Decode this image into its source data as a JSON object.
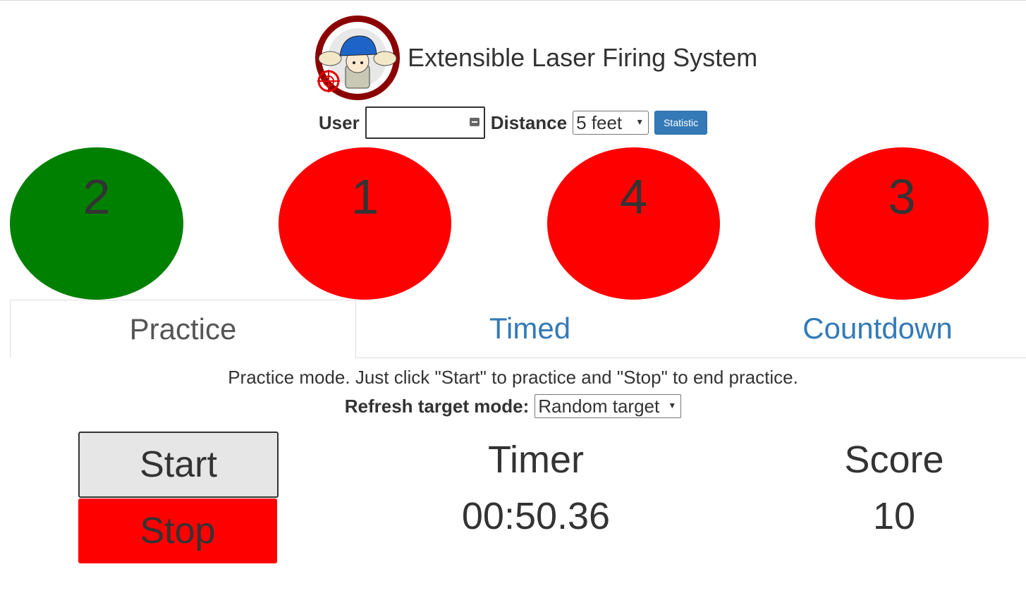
{
  "app": {
    "title": "Extensible Laser Firing System"
  },
  "controls": {
    "user_label": "User",
    "user_value": "",
    "distance_label": "Distance",
    "distance_selected": "5 feet",
    "statistic_button": "Statistic"
  },
  "targets": [
    {
      "number": "2",
      "color": "#008000"
    },
    {
      "number": "1",
      "color": "#ff0000"
    },
    {
      "number": "4",
      "color": "#ff0000"
    },
    {
      "number": "3",
      "color": "#ff0000"
    }
  ],
  "tabs": [
    {
      "label": "Practice",
      "active": true
    },
    {
      "label": "Timed",
      "active": false
    },
    {
      "label": "Countdown",
      "active": false
    }
  ],
  "practice": {
    "description": "Practice mode. Just click \"Start\" to practice and \"Stop\" to end practice.",
    "refresh_label": "Refresh target mode:",
    "refresh_selected": "Random target"
  },
  "buttons": {
    "start": "Start",
    "stop": "Stop"
  },
  "timer": {
    "label": "Timer",
    "value": "00:50.36"
  },
  "score": {
    "label": "Score",
    "value": "10"
  },
  "colors": {
    "accent": "#337ab7",
    "active_target": "#008000",
    "inactive_target": "#ff0000",
    "stop": "#ff0000"
  }
}
